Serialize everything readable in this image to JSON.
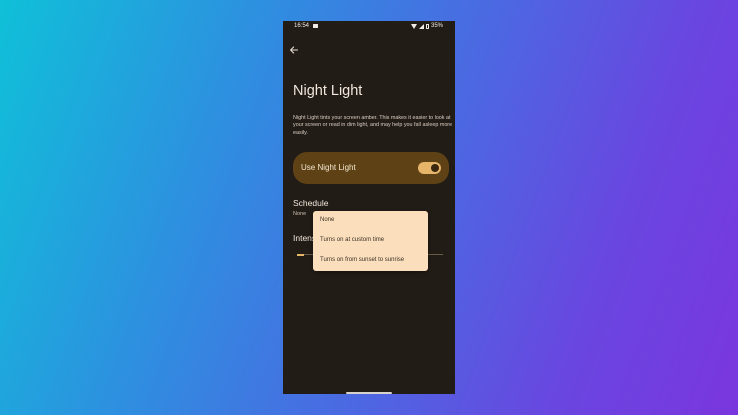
{
  "status_bar": {
    "time": "16:54",
    "battery": "35%",
    "icons": [
      "notification-square-icon",
      "wifi-icon",
      "signal-icon",
      "battery-icon"
    ]
  },
  "page": {
    "title": "Night Light",
    "description": "Night Light tints your screen amber. This makes it easier to look at your screen or read in dim light, and may help you fall asleep more easily."
  },
  "toggle": {
    "label": "Use Night Light",
    "checked": true
  },
  "schedule": {
    "title": "Schedule",
    "value": "None"
  },
  "intensity": {
    "title": "Intensity",
    "level": 0.05
  },
  "dropdown": {
    "options": [
      "None",
      "Turns on at custom time",
      "Turns on from sunset to sunrise"
    ]
  },
  "colors": {
    "accent": "#e6b56a",
    "card": "#5e4216",
    "background": "#221c16",
    "menu": "#fbdfbd"
  }
}
